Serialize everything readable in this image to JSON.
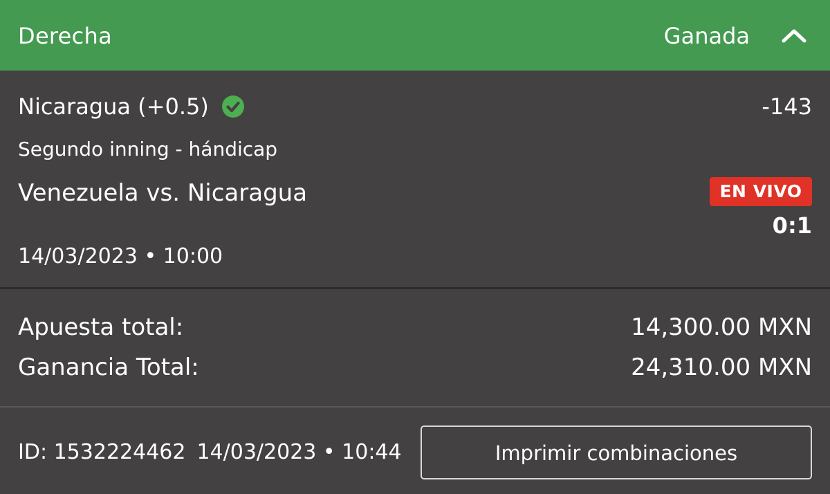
{
  "header": {
    "title": "Derecha",
    "status": "Ganada",
    "collapse_icon": "chevron-up-icon",
    "background_color": "#449a51"
  },
  "selection": {
    "name": "Nicaragua (+0.5)",
    "result_icon": "check-circle-icon",
    "result_color": "#4caf50",
    "odds": "-143",
    "market": "Segundo inning - hándicap",
    "event": "Venezuela vs. Nicaragua",
    "live_badge": "EN VIVO",
    "live_color": "#e03226",
    "score": "0:1",
    "event_datetime": "14/03/2023 • 10:00"
  },
  "totals": {
    "stake_label": "Apuesta total:",
    "stake_value": "14,300.00 MXN",
    "winnings_label": "Ganancia Total:",
    "winnings_value": "24,310.00 MXN"
  },
  "footer": {
    "bet_id": "ID: 1532224462",
    "placed_datetime": "14/03/2023 • 10:44",
    "print_button_label": "Imprimir combinaciones"
  }
}
